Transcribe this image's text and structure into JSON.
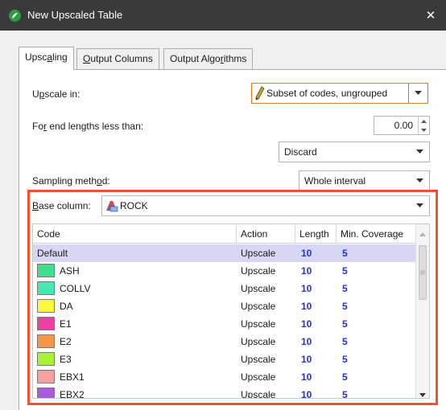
{
  "window": {
    "title": "New Upscaled Table",
    "close_label": "✕"
  },
  "tabs": [
    {
      "label_pre": "Upsc",
      "label_u": "a",
      "label_post": "ling"
    },
    {
      "label_pre": "",
      "label_u": "O",
      "label_post": "utput Columns"
    },
    {
      "label_pre": "Output Algo",
      "label_u": "r",
      "label_post": "ithms"
    }
  ],
  "form": {
    "upscale_in_label_pre": "U",
    "upscale_in_label_u": "p",
    "upscale_in_label_post": "scale in:",
    "upscale_in_value": "Subset of codes, ungrouped",
    "end_lengths_label_pre": "Fo",
    "end_lengths_label_u": "r",
    "end_lengths_label_post": " end lengths less than:",
    "end_lengths_value": "0.00",
    "end_action_value": "Discard",
    "sampling_label_pre": "Sampling meth",
    "sampling_label_u": "o",
    "sampling_label_post": "d:",
    "sampling_value": "Whole interval",
    "base_column_label_pre": "",
    "base_column_label_u": "B",
    "base_column_label_post": "ase column:",
    "base_column_value": "ROCK"
  },
  "table": {
    "headers": [
      "Code",
      "Action",
      "Length",
      "Min. Coverage"
    ],
    "rows": [
      {
        "code": "Default",
        "action": "Upscale",
        "length": "10",
        "coverage": "5",
        "color": ""
      },
      {
        "code": "ASH",
        "action": "Upscale",
        "length": "10",
        "coverage": "5",
        "color": "#3ee08f"
      },
      {
        "code": "COLLV",
        "action": "Upscale",
        "length": "10",
        "coverage": "5",
        "color": "#45e8b0"
      },
      {
        "code": "DA",
        "action": "Upscale",
        "length": "10",
        "coverage": "5",
        "color": "#fafa3a"
      },
      {
        "code": "E1",
        "action": "Upscale",
        "length": "10",
        "coverage": "5",
        "color": "#f03ea6"
      },
      {
        "code": "E2",
        "action": "Upscale",
        "length": "10",
        "coverage": "5",
        "color": "#f59546"
      },
      {
        "code": "E3",
        "action": "Upscale",
        "length": "10",
        "coverage": "5",
        "color": "#a9f03a"
      },
      {
        "code": "EBX1",
        "action": "Upscale",
        "length": "10",
        "coverage": "5",
        "color": "#f5a0a0"
      },
      {
        "code": "EBX2",
        "action": "Upscale",
        "length": "10",
        "coverage": "5",
        "color": "#a95bd9"
      }
    ]
  },
  "colors": {
    "highlight": "#f0542d",
    "accent_orange": "#e07b22",
    "selected_row": "#d6d7f5",
    "number_blue": "#2a2fd1"
  },
  "icons": {
    "app": "leapfrog-app-icon",
    "pencil": "pencil-icon",
    "rock": "column-table-icon"
  }
}
